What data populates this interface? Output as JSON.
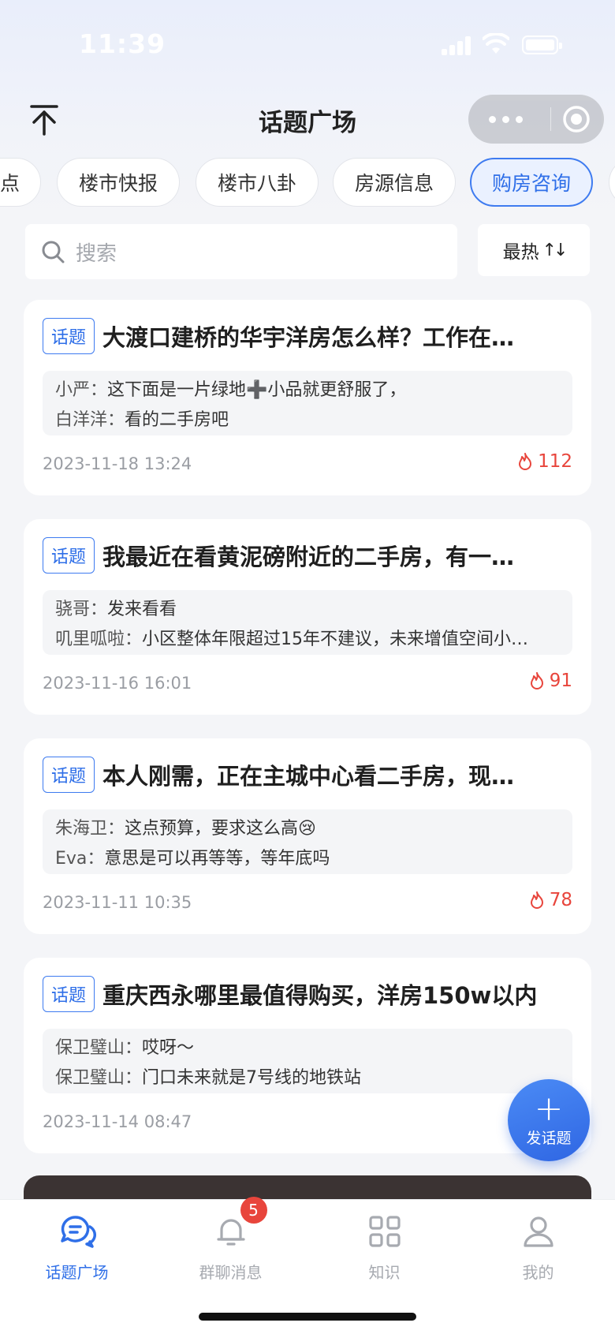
{
  "status_bar": {
    "time": "11:39"
  },
  "nav": {
    "title": "话题广场"
  },
  "tabs": [
    {
      "label": "点",
      "active": false
    },
    {
      "label": "楼市快报",
      "active": false
    },
    {
      "label": "楼市八卦",
      "active": false
    },
    {
      "label": "房源信息",
      "active": false
    },
    {
      "label": "购房咨询",
      "active": true
    }
  ],
  "search": {
    "placeholder": "搜索"
  },
  "sort": {
    "label": "最热",
    "arrows": "↑↓"
  },
  "tag_label": "话题",
  "cards": [
    {
      "title": "大渡口建桥的华宇洋房怎么样？工作在…",
      "comments": [
        {
          "user": "小严：",
          "text": "这下面是一片绿地➕小品就更舒服了，"
        },
        {
          "user": "白洋洋：",
          "text": "看的二手房吧"
        }
      ],
      "date": "2023-11-18 13:24",
      "hot": "112"
    },
    {
      "title": "我最近在看黄泥磅附近的二手房，有一…",
      "comments": [
        {
          "user": "骁哥：",
          "text": "发来看看"
        },
        {
          "user": "叽里呱啦：",
          "text": "小区整体年限超过15年不建议，未来增值空间小…"
        }
      ],
      "date": "2023-11-16 16:01",
      "hot": "91"
    },
    {
      "title": "本人刚需，正在主城中心看二手房，现…",
      "comments": [
        {
          "user": "朱海卫：",
          "text": "这点预算，要求这么高😢"
        },
        {
          "user": "Eva：",
          "text": "意思是可以再等等，等年底吗"
        }
      ],
      "date": "2023-11-11 10:35",
      "hot": "78"
    },
    {
      "title": "重庆西永哪里最值得购买，洋房150w以内",
      "comments": [
        {
          "user": "保卫璧山：",
          "text": "哎呀～"
        },
        {
          "user": "保卫璧山：",
          "text": "门口未来就是7号线的地铁站"
        }
      ],
      "date": "2023-11-14 08:47",
      "hot": ""
    }
  ],
  "fab": {
    "plus": "+",
    "label": "发话题"
  },
  "tabbar": [
    {
      "label": "话题广场",
      "icon": "chat-bubbles-icon",
      "active": true
    },
    {
      "label": "群聊消息",
      "icon": "bell-icon",
      "active": false,
      "badge": "5"
    },
    {
      "label": "知识",
      "icon": "grid-icon",
      "active": false
    },
    {
      "label": "我的",
      "icon": "user-icon",
      "active": false
    }
  ],
  "colors": {
    "accent": "#2f6fe8",
    "hot": "#e8453c",
    "background": "#f4f5f8"
  }
}
